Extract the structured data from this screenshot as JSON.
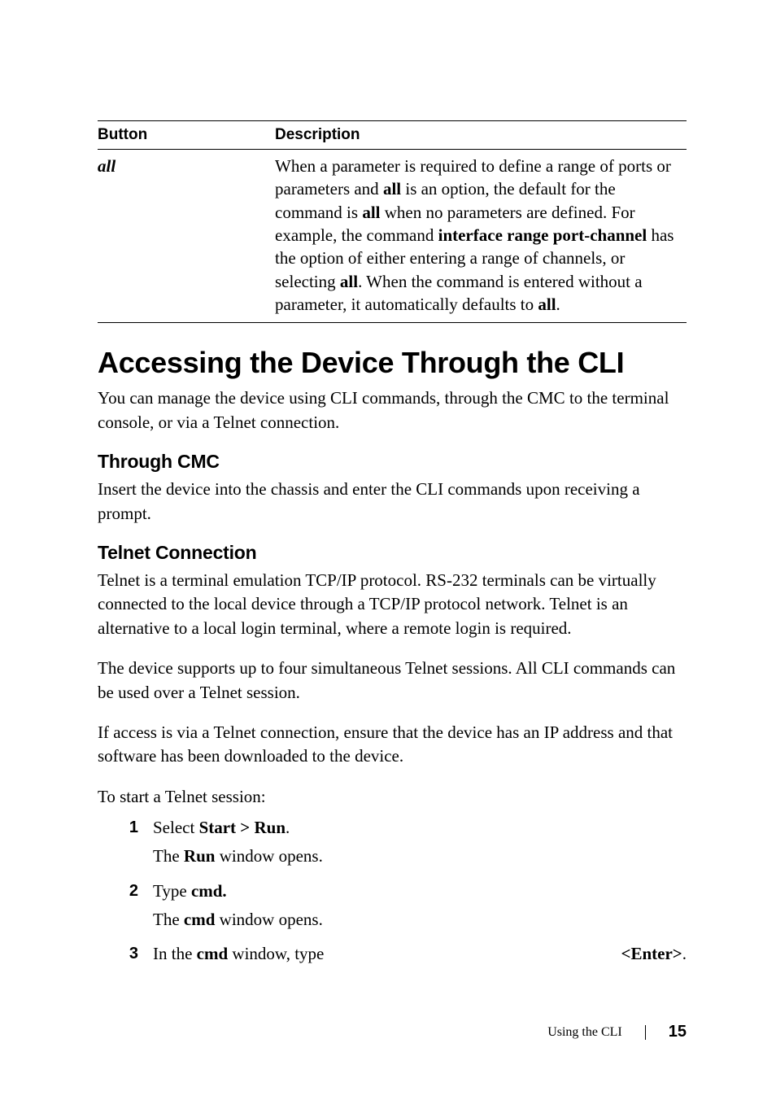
{
  "table": {
    "headers": [
      "Button",
      "Description"
    ],
    "row": {
      "c0": "all",
      "c1_pre": "When a parameter is required to define a range of ports or parameters and ",
      "c1_b1": "all",
      "c1_mid1": " is an option, the default for the command is ",
      "c1_b2": "all",
      "c1_mid2": " when no parameters are defined. For example, the command ",
      "c1_b3": "interface range port-channel",
      "c1_mid3": " has the option of either entering a range of channels, or selecting ",
      "c1_b4": "all",
      "c1_mid4": ". When the command is entered without a parameter, it automatically defaults to ",
      "c1_b5": "all",
      "c1_end": "."
    }
  },
  "h1": "Accessing the Device Through the CLI",
  "intro": "You can manage the device using CLI commands, through the CMC to the terminal console, or via a Telnet connection.",
  "sec_cmc": {
    "title": "Through CMC",
    "p": "Insert the device into the chassis and enter the CLI commands upon receiving a prompt."
  },
  "sec_telnet": {
    "title": "Telnet Connection",
    "p1": "Telnet is a terminal emulation TCP/IP protocol. RS-232 terminals can be virtually connected to the local device through a TCP/IP protocol network. Telnet is an alternative to a local login terminal, where a remote login is required.",
    "p2": "The device supports up to four simultaneous Telnet sessions. All CLI commands can be used over a Telnet session.",
    "p3": "If access is via a Telnet connection, ensure that the device has an IP address and that software has been downloaded to the device.",
    "p4": "To start a Telnet session:"
  },
  "steps": {
    "s1_num": "1",
    "s1_pre": "Select ",
    "s1_bold": "Start > Run",
    "s1_post": ".",
    "s1_sub_pre": "The ",
    "s1_sub_bold": "Run",
    "s1_sub_post": " window opens.",
    "s2_num": "2",
    "s2_pre": "Type ",
    "s2_bold": "cmd.",
    "s2_sub_pre": "The ",
    "s2_sub_bold": "cmd",
    "s2_sub_post": " window opens.",
    "s3_num": "3",
    "s3_pre": "In the ",
    "s3_bold1": "cmd",
    "s3_mid": " window, type ",
    "s3_bold2": "<Enter>",
    "s3_post": "."
  },
  "footer": {
    "section": "Using the CLI",
    "page": "15"
  }
}
